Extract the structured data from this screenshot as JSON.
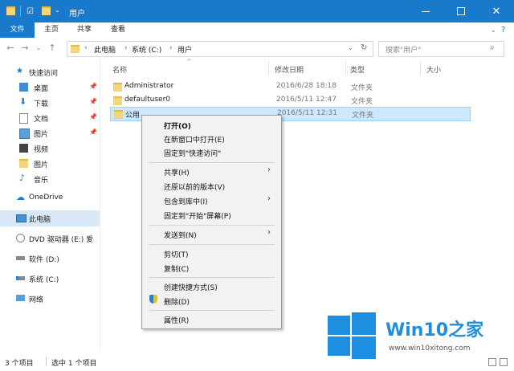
{
  "window": {
    "title": "用户"
  },
  "ribbon": {
    "tabs": [
      "文件",
      "主页",
      "共享",
      "查看"
    ]
  },
  "address": {
    "crumbs": [
      "此电脑",
      "系统 (C:)",
      "用户"
    ],
    "search_placeholder": "搜索\"用户\""
  },
  "sidebar": {
    "quick_access": "快速访问",
    "pinned": [
      "桌面",
      "下载",
      "文档",
      "图片"
    ],
    "items": [
      "视频",
      "图片",
      "音乐"
    ],
    "onedrive": "OneDrive",
    "this_pc": "此电脑",
    "drives": [
      "DVD 驱动器 (E:) 爱",
      "软件 (D:)",
      "系统 (C:)"
    ],
    "network": "网络"
  },
  "columns": {
    "name": "名称",
    "date": "修改日期",
    "type": "类型",
    "size": "大小"
  },
  "files": [
    {
      "name": "Administrator",
      "date": "2016/6/28 18:18",
      "type": "文件夹"
    },
    {
      "name": "defaultuser0",
      "date": "2016/5/11 12:47",
      "type": "文件夹"
    },
    {
      "name": "公用",
      "date": "2016/5/11 12:31",
      "type": "文件夹"
    }
  ],
  "context_menu": {
    "open": "打开(O)",
    "open_new_window": "在新窗口中打开(E)",
    "pin_quick": "固定到\"快速访问\"",
    "share": "共享(H)",
    "restore": "还原以前的版本(V)",
    "include_lib": "包含到库中(I)",
    "pin_start": "固定到\"开始\"屏幕(P)",
    "send_to": "发送到(N)",
    "cut": "剪切(T)",
    "copy": "复制(C)",
    "shortcut": "创建快捷方式(S)",
    "delete": "删除(D)",
    "properties": "属性(R)"
  },
  "status": {
    "count": "3 个项目",
    "selected": "选中 1 个项目"
  },
  "watermark": {
    "brand": "Win10之家",
    "url": "www.win10xitong.com"
  },
  "colors": {
    "accent": "#1979ca",
    "selection": "#cce8ff",
    "logo": "#1e8ee0"
  }
}
